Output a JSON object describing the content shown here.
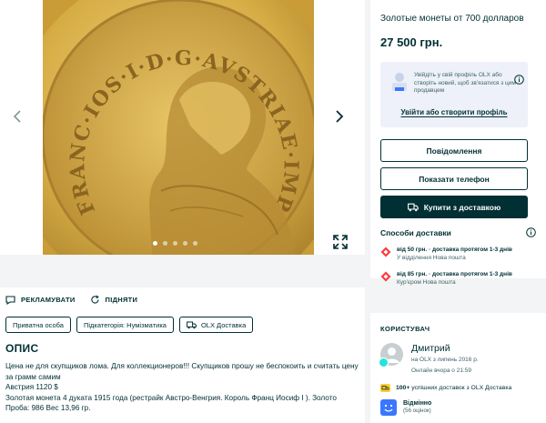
{
  "gallery": {
    "coin_legend": "FRANC·IOS·I·D·G·AVSTRIAE·IMPERATOR",
    "slide_count": 5,
    "active_slide": 1
  },
  "actions": {
    "promote_label": "РЕКЛАМУВАТИ",
    "raise_label": "ПІДНЯТИ"
  },
  "tags": [
    {
      "label": "Приватна особа"
    },
    {
      "label": "Підкатегорія: Нумізматика"
    },
    {
      "label": "OLX Доставка"
    }
  ],
  "description": {
    "title": "ОПИС",
    "body": "Цена не для скупщиков лома. Для коллекционеров!!! Скупщиков прошу не беспокоить и считать цену за грамм самим\nАвстрия 1120 $\nЗолотая монета 4 дуката 1915 года (рестрайк Австро-Венгрия. Король Франц Иосиф I ). Золото Проба: 986 Вес 13,96 гр."
  },
  "ad": {
    "title": "Золотые монеты от 700 долларов",
    "price": "27 500 грн."
  },
  "login_prompt": {
    "text": "Увійдіть у свій профіль OLX або створіть новий, щоб зв'язатися з цим продавцем",
    "link": "Увійти або створити профіль"
  },
  "buttons": {
    "message": "Повідомлення",
    "show_phone": "Показати телефон",
    "buy_delivery": "Купити з доставкою"
  },
  "delivery": {
    "title": "Способи доставки",
    "options": [
      {
        "line1": "від 50 грн. · доставка протягом 1-3 днів",
        "line2": "У відділення Нова пошта"
      },
      {
        "line1": "від 85 грн. · доставка протягом 1-3 днів",
        "line2": "Кур'єром Нова пошта"
      }
    ]
  },
  "user": {
    "header": "КОРИСТУВАЧ",
    "name": "Дмитрий",
    "since": "на OLX з липень 2016 р.",
    "online": "Онлайн вчора о 21:59",
    "deliveries_count": "100+",
    "deliveries_text": "успішних доставок з OLX Доставка",
    "rating_title": "Відмінно",
    "rating_sub": "(56 оцінок)"
  },
  "colors": {
    "olx_dark": "#002f34",
    "page_bg": "#f2f4f5",
    "login_bg": "#eef1f9",
    "gold": "#cfa640",
    "olx_teal": "#23e5db",
    "delivery_red": "#ff3939",
    "rating_blue": "#3a77ff"
  },
  "icons": {
    "promote": "megaphone-icon",
    "raise": "refresh-icon",
    "delivery": "truck-icon",
    "info": "info-icon",
    "expand": "expand-icon",
    "nova_poshta": "nova-poshta-icon"
  }
}
